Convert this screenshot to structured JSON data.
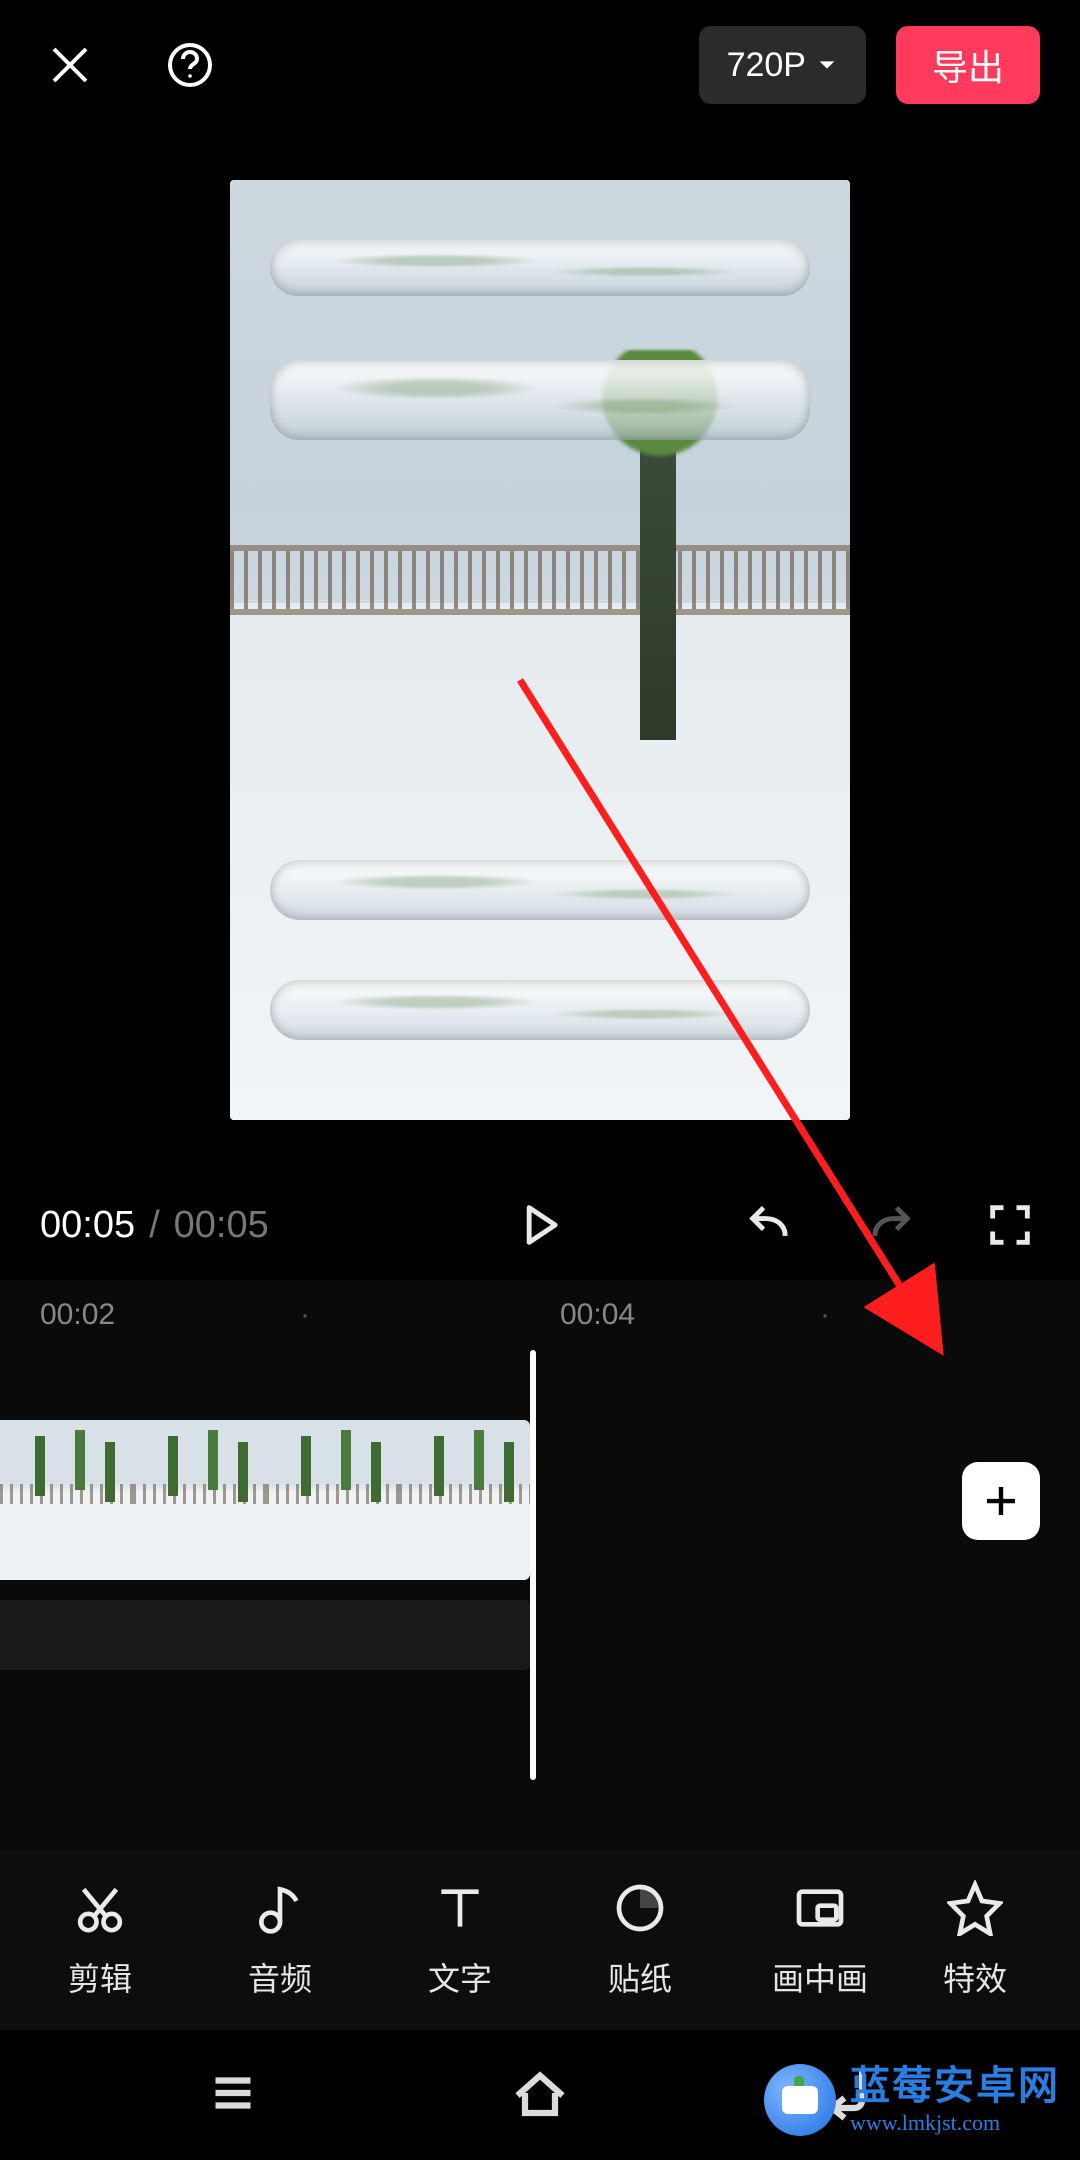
{
  "header": {
    "resolution_label": "720P",
    "export_label": "导出"
  },
  "playback": {
    "current_time": "00:05",
    "separator": "/",
    "total_time": "00:05"
  },
  "ruler": {
    "labels": [
      "00:02",
      "00:04"
    ]
  },
  "toolbar": {
    "items": [
      {
        "icon": "scissors",
        "label": "剪辑"
      },
      {
        "icon": "music-note",
        "label": "音频"
      },
      {
        "icon": "text-T",
        "label": "文字"
      },
      {
        "icon": "sticker",
        "label": "贴纸"
      },
      {
        "icon": "pip-square",
        "label": "画中画"
      },
      {
        "icon": "star",
        "label": "特效"
      }
    ]
  },
  "watermark": {
    "line1": "蓝莓安卓网",
    "line2": "www.lmkjst.com"
  }
}
